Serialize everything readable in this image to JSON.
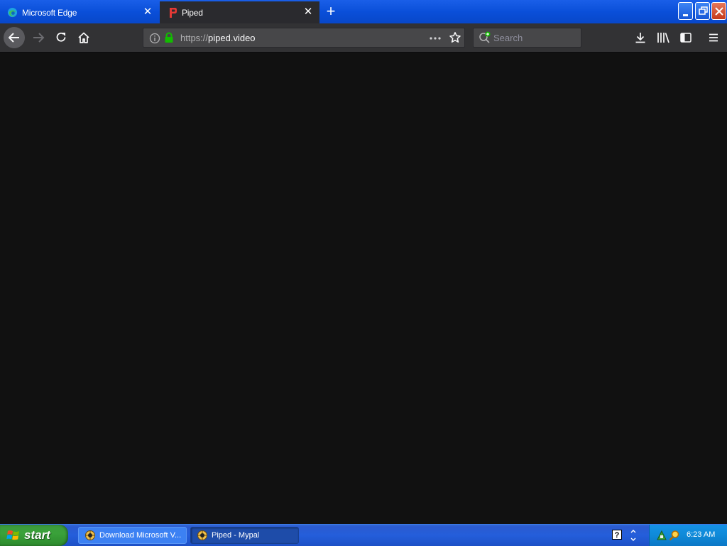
{
  "tabs": [
    {
      "title": "Microsoft Edge",
      "icon": "edge-icon",
      "active": false
    },
    {
      "title": "Piped",
      "icon": "piped-icon",
      "active": true
    }
  ],
  "window_controls": [
    "minimize",
    "maximize",
    "close"
  ],
  "navbar": {
    "url_scheme": "https://",
    "url_host": "piped.video",
    "search_placeholder": "Search"
  },
  "taskbar": {
    "start_label": "start",
    "items": [
      {
        "label": "Download Microsoft V...",
        "icon": "browser-icon"
      },
      {
        "label": "Piped - Mypal",
        "icon": "browser-icon",
        "active": true
      }
    ],
    "clock": "6:23 AM"
  },
  "colors": {
    "content_bg": "#111111",
    "toolbar_bg": "#323234",
    "tab_active_bg": "#2a2a2e",
    "titlebar_blue": "#0a4fd9",
    "lock_green": "#12bc00",
    "start_green": "#3aa23a"
  }
}
